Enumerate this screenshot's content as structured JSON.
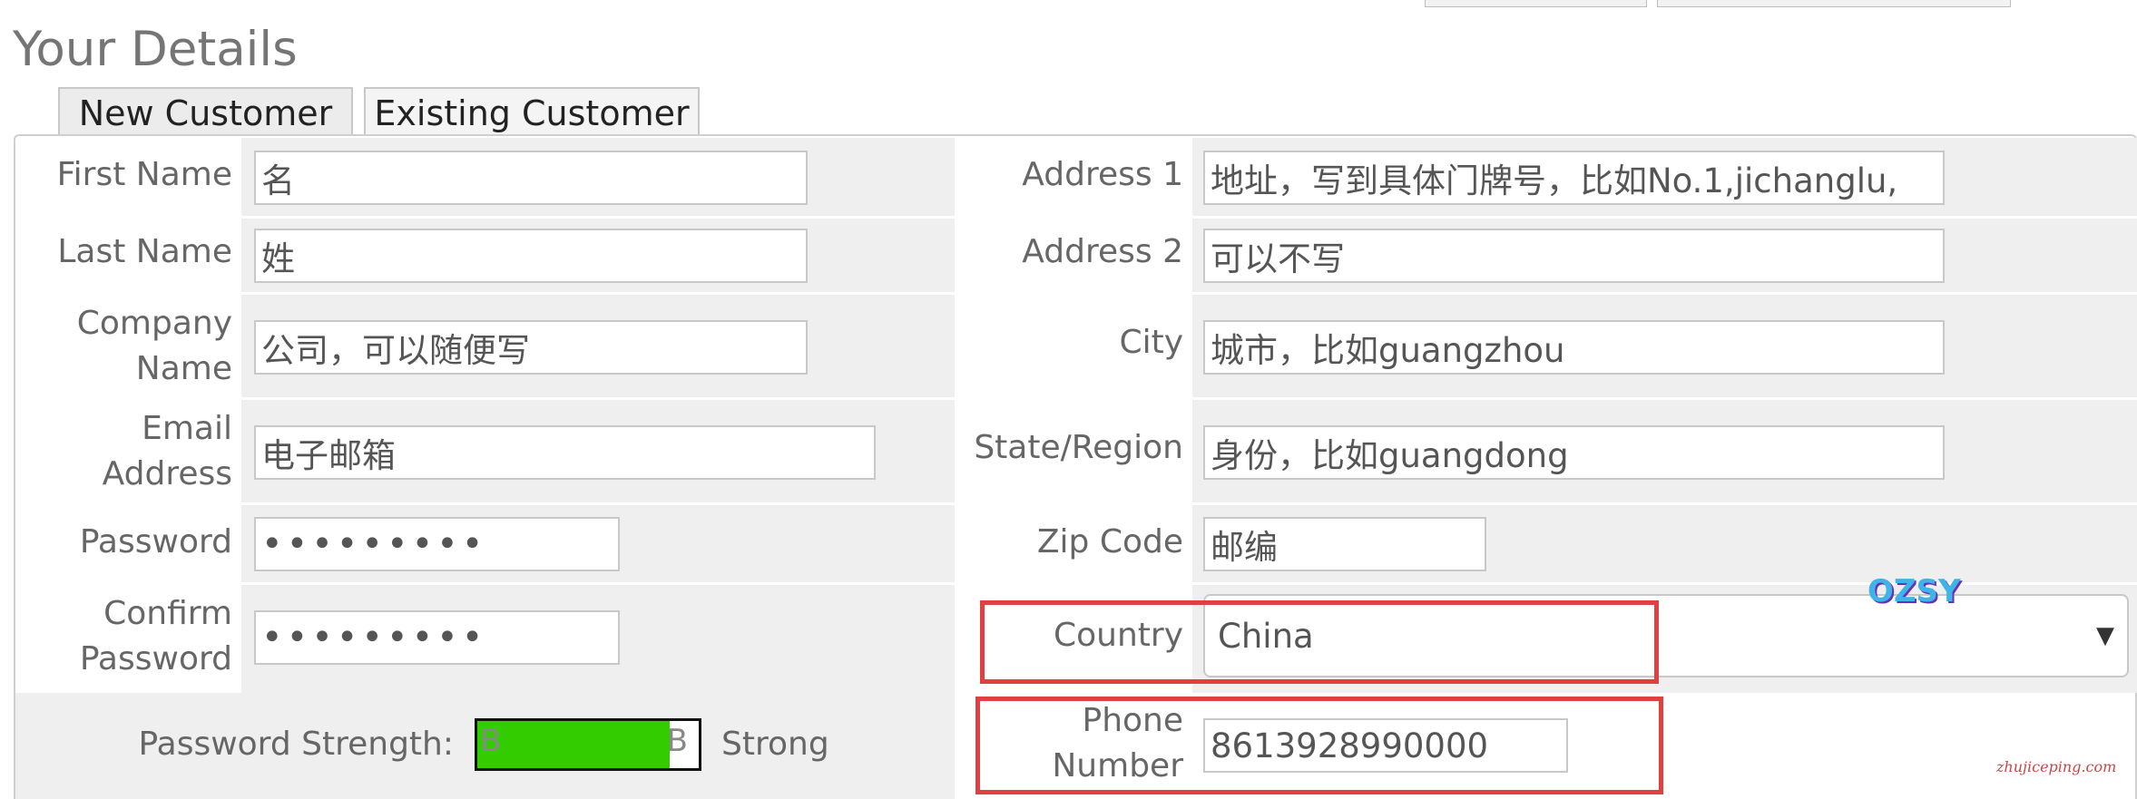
{
  "page": {
    "title": "Your Details",
    "watermark": "zhujiceping.com",
    "logo_text": "OZSY"
  },
  "tabs": [
    {
      "label": "New Customer",
      "active": true
    },
    {
      "label": "Existing Customer",
      "active": false
    }
  ],
  "left": {
    "first_name": {
      "label": "First Name",
      "value": "名"
    },
    "last_name": {
      "label": "Last Name",
      "value": "姓"
    },
    "company": {
      "label_line1": "Company",
      "label_line2": "Name",
      "value": "公司，可以随便写"
    },
    "email": {
      "label_line1": "Email",
      "label_line2": "Address",
      "value": "电子邮箱"
    },
    "password": {
      "label": "Password",
      "value": "•••••••••"
    },
    "confirm": {
      "label_line1": "Confirm",
      "label_line2": "Password",
      "value": "•••••••••"
    },
    "strength": {
      "label": "Password Strength:",
      "bar_left_char": "B",
      "bar_right_char": "B",
      "text": "Strong",
      "fill_fraction": 0.87,
      "fill_color": "#33cc00"
    }
  },
  "right": {
    "address1": {
      "label": "Address 1",
      "value": "地址，写到具体门牌号，比如No.1,jichanglu,"
    },
    "address2": {
      "label": "Address 2",
      "value": "可以不写"
    },
    "city": {
      "label": "City",
      "value": "城市，比如guangzhou"
    },
    "state": {
      "label": "State/Region",
      "value": "身份，比如guangdong"
    },
    "zip": {
      "label": "Zip Code",
      "value": "邮编"
    },
    "country": {
      "label": "Country",
      "value": "China",
      "icon": "chevron-down-icon"
    },
    "phone": {
      "label_line1": "Phone",
      "label_line2": "Number",
      "value": "8613928990000"
    }
  },
  "colors": {
    "highlight_border": "#e04040",
    "row_background": "#efefef"
  }
}
